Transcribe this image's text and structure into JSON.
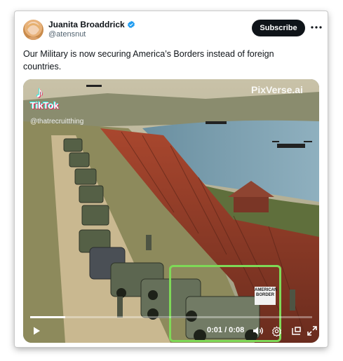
{
  "tweet": {
    "author_name": "Juanita Broaddrick",
    "author_handle": "@atensnut",
    "subscribe_label": "Subscribe",
    "text": "Our Military is now securing America’s Borders instead of foreign countries."
  },
  "media": {
    "watermark_tiktok": "TikTok",
    "watermark_user": "@thatrecruitthing",
    "watermark_pixverse": "PixVerse.ai",
    "sign_text": "AMERICAN BORDER",
    "time_display": "0:01 / 0:08",
    "progress": 0.125
  },
  "icons": {
    "verified": "verified-badge-icon",
    "more": "more-options-icon",
    "play": "play-icon",
    "volume": "volume-icon",
    "settings": "settings-icon",
    "pip": "picture-in-picture-icon",
    "fullscreen": "fullscreen-icon"
  },
  "colors": {
    "subscribe_bg": "#0f1419",
    "verified": "#1d9bf0",
    "highlight": "#7ed957"
  }
}
